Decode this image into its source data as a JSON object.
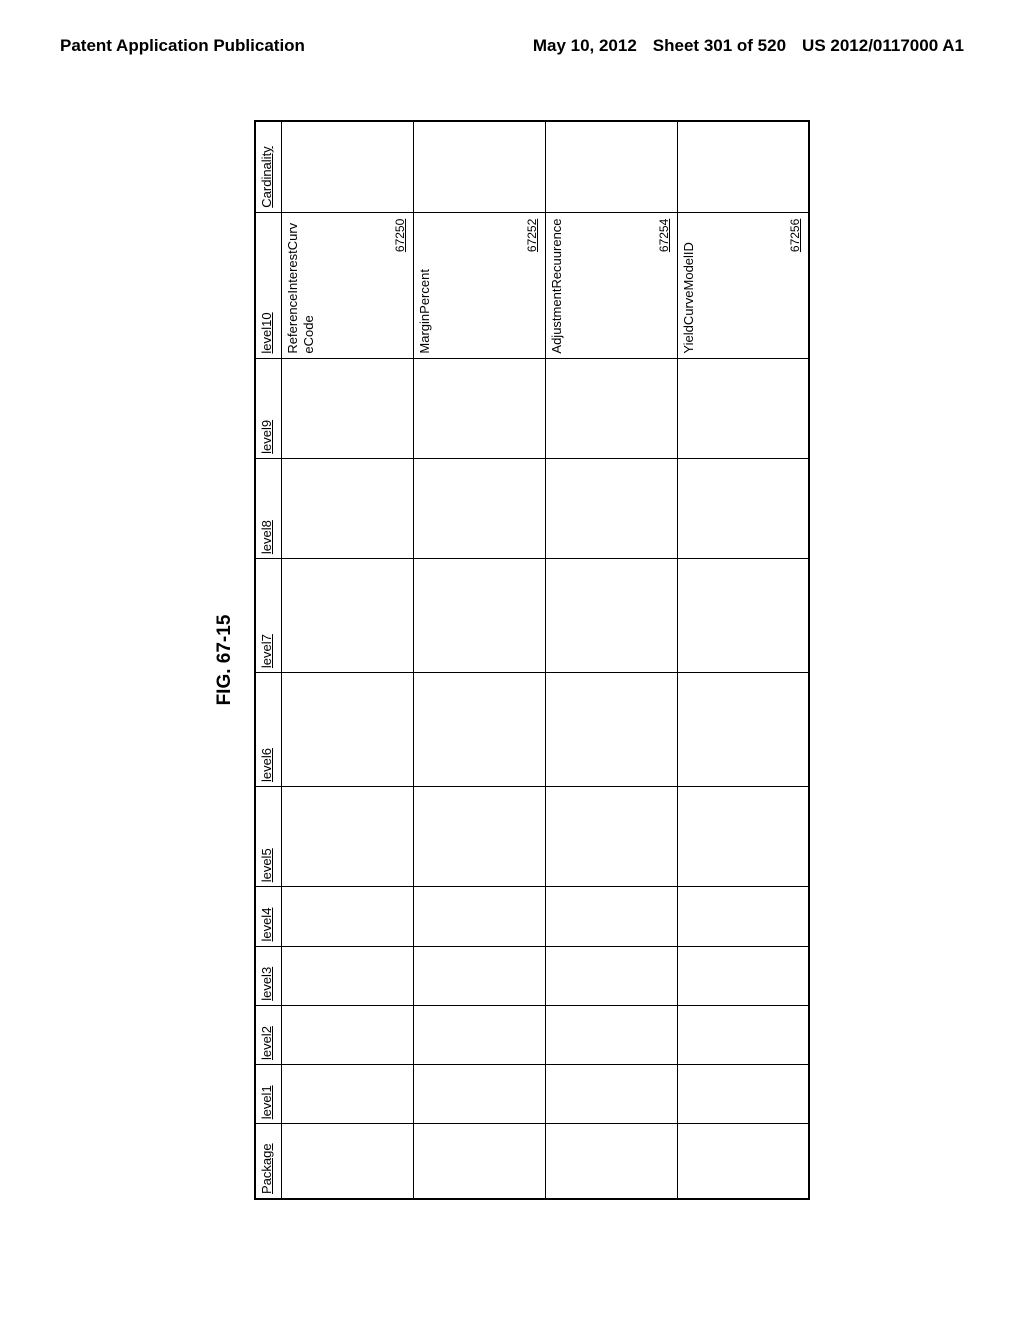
{
  "header": {
    "left": "Patent Application Publication",
    "date": "May 10, 2012",
    "sheet": "Sheet 301 of 520",
    "pubnum": "US 2012/0117000 A1"
  },
  "figure_label": "FIG. 67-15",
  "table": {
    "columns": [
      "Package",
      "level1",
      "level2",
      "level3",
      "level4",
      "level5",
      "level6",
      "level7",
      "level8",
      "level9",
      "level10",
      "Cardinality"
    ],
    "rows": [
      {
        "level10_text": "ReferenceInterestCurveCode",
        "ref": "67250"
      },
      {
        "level10_text": "MarginPercent",
        "ref": "67252"
      },
      {
        "level10_text": "AdjustmentRecuurence",
        "ref": "67254"
      },
      {
        "level10_text": "YieldCurveModelID",
        "ref": "67256"
      }
    ]
  }
}
